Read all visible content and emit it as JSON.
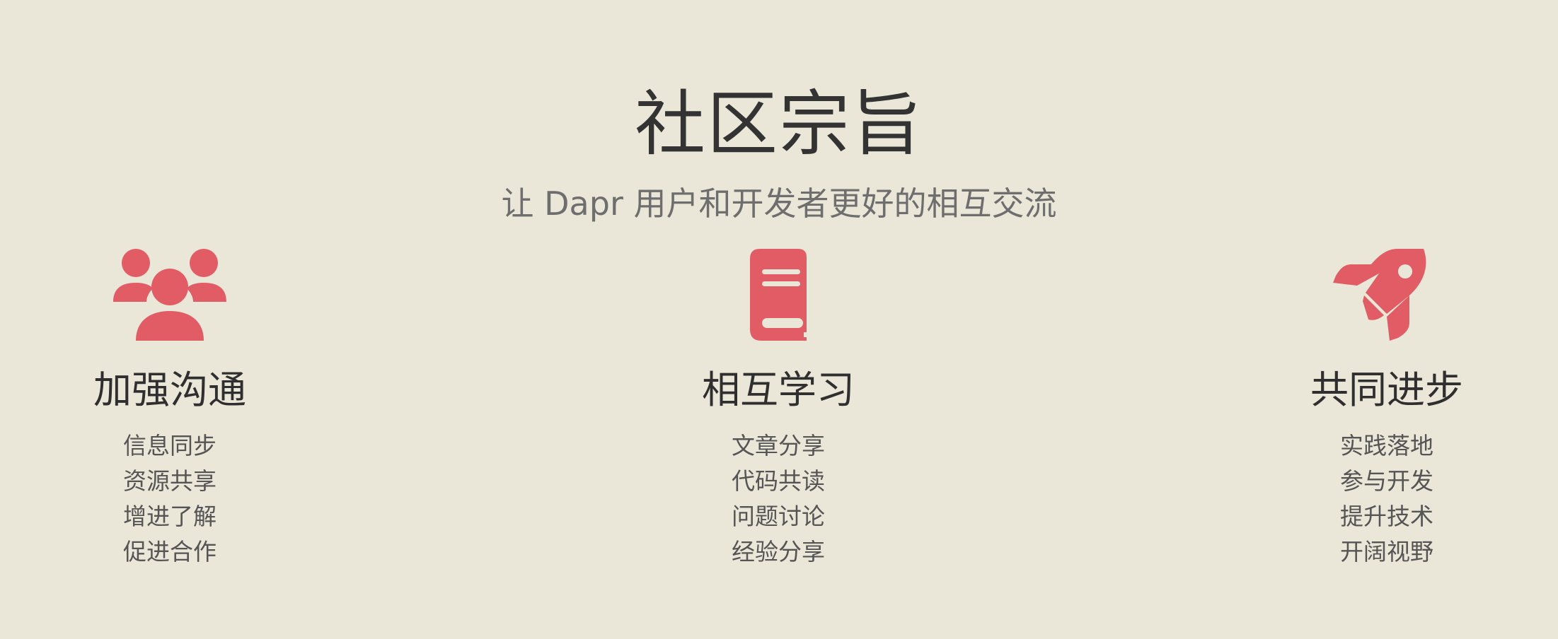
{
  "title": "社区宗旨",
  "subtitle": "让 Dapr 用户和开发者更好的相互交流",
  "accent_color": "#e15c64",
  "columns": [
    {
      "icon": "users-icon",
      "heading": "加强沟通",
      "items": [
        "信息同步",
        "资源共享",
        "增进了解",
        "促进合作"
      ]
    },
    {
      "icon": "book-icon",
      "heading": "相互学习",
      "items": [
        "文章分享",
        "代码共读",
        "问题讨论",
        "经验分享"
      ]
    },
    {
      "icon": "rocket-icon",
      "heading": "共同进步",
      "items": [
        "实践落地",
        "参与开发",
        "提升技术",
        "开阔视野"
      ]
    }
  ]
}
